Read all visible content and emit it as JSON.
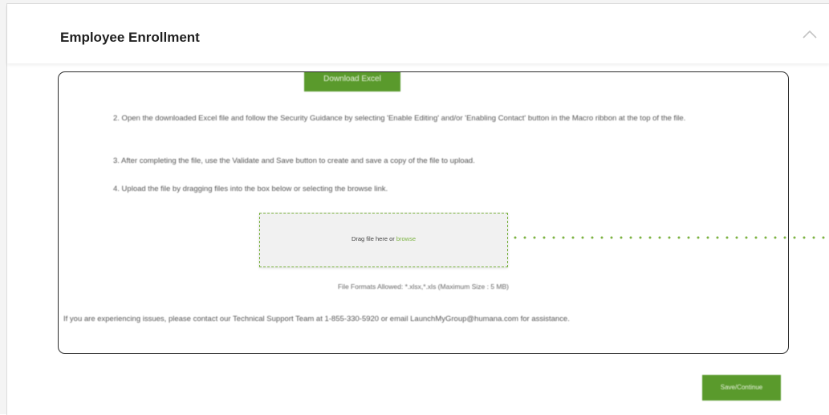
{
  "section": {
    "title": "Employee Enrollment",
    "collapse_icon": "chevron-up-icon"
  },
  "instructions": {
    "download_button_label": "Download Excel",
    "step2": "2. Open the downloaded Excel file and follow the Security Guidance by selecting 'Enable Editing' and/or 'Enabling Contact' button in the Macro ribbon at the top of the file.",
    "step3": "3. After completing the file, use the Validate and Save button to create and save a copy of the file to upload.",
    "step4": "4. Upload the file by dragging files into the box below or selecting the browse link."
  },
  "upload": {
    "drop_text": "Drag file here or",
    "browse_label": "browse",
    "formats_note": "File Formats Allowed: *.xlsx,*.xls (Maximum Size : 5 MB)"
  },
  "support": {
    "text": "If you are experiencing issues, please contact our Technical Support Team at 1-855-330-5920 or email LaunchMyGroup@humana.com for assistance."
  },
  "footer": {
    "save_button_label": "Save/Continue"
  },
  "colors": {
    "accent_green": "#5a9a2c",
    "link_green": "#7cb342",
    "connector_dots": "#7cb342"
  }
}
